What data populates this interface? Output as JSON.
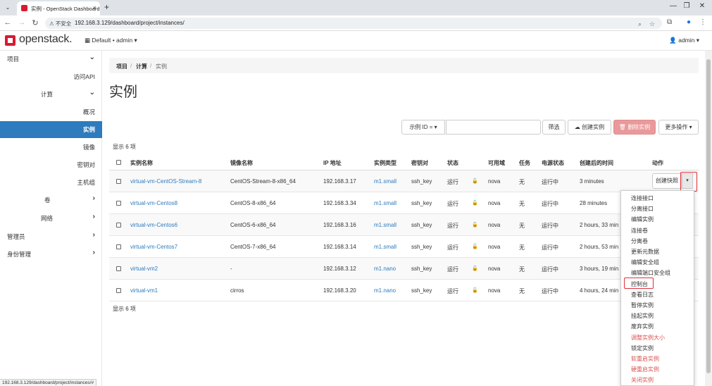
{
  "browser": {
    "tab_title": "实例 - OpenStack Dashboard",
    "tab_close": "×",
    "new_tab": "+",
    "insecure_label": "不安全",
    "url": "192.168.3.129/dashboard/project/instances/",
    "status_url": "192.168.3.129/dashboard/project/instances/#"
  },
  "header": {
    "logo": "openstack.",
    "project_picker": "Default • admin ▾",
    "user_menu": "admin ▾"
  },
  "sidebar": {
    "items": [
      {
        "label": "项目",
        "chevron": "⌄"
      },
      {
        "label": "访问API"
      },
      {
        "label": "计算",
        "chevron": "⌄"
      },
      {
        "label": "概况"
      },
      {
        "label": "实例"
      },
      {
        "label": "镜像"
      },
      {
        "label": "密钥对"
      },
      {
        "label": "主机组"
      },
      {
        "label": "卷",
        "chevron": "›"
      },
      {
        "label": "网络",
        "chevron": "›"
      },
      {
        "label": "管理员",
        "chevron": "›"
      },
      {
        "label": "身份管理",
        "chevron": "›"
      }
    ]
  },
  "breadcrumb": {
    "b1": "项目",
    "b2": "计算",
    "b3": "实例",
    "sep": "/"
  },
  "page_title": "实例",
  "toolbar": {
    "filter_select": "示例 ID = ▾",
    "filter_btn": "筛选",
    "create_btn": "创建实例",
    "delete_btn": "删除实例",
    "more_btn": "更多操作 ▾"
  },
  "count_label": "显示 6 项",
  "table": {
    "headers": [
      "实例名称",
      "镜像名称",
      "IP 地址",
      "实例类型",
      "密钥对",
      "状态",
      "可用域",
      "任务",
      "电源状态",
      "创建后的时间",
      "动作"
    ],
    "rows": [
      {
        "name": "virtual-vm-CentOS-Stream-8",
        "image": "CentOS-Stream-8-x86_64",
        "ip": "192.168.3.17",
        "flavor": "m1.small",
        "key": "ssh_key",
        "status": "运行",
        "zone": "nova",
        "task": "无",
        "power": "运行中",
        "age": "3 minutes"
      },
      {
        "name": "virtual-vm-Centos8",
        "image": "CentOS-8-x86_64",
        "ip": "192.168.3.34",
        "flavor": "m1.small",
        "key": "ssh_key",
        "status": "运行",
        "zone": "nova",
        "task": "无",
        "power": "运行中",
        "age": "28 minutes"
      },
      {
        "name": "virtual-vm-Centos6",
        "image": "CentOS-6-x86_64",
        "ip": "192.168.3.16",
        "flavor": "m1.small",
        "key": "ssh_key",
        "status": "运行",
        "zone": "nova",
        "task": "无",
        "power": "运行中",
        "age": "2 hours, 33 min"
      },
      {
        "name": "virtual-vm-Centos7",
        "image": "CentOS-7-x86_64",
        "ip": "192.168.3.14",
        "flavor": "m1.small",
        "key": "ssh_key",
        "status": "运行",
        "zone": "nova",
        "task": "无",
        "power": "运行中",
        "age": "2 hours, 53 min"
      },
      {
        "name": "virtual-vm2",
        "image": "-",
        "ip": "192.168.3.12",
        "flavor": "m1.nano",
        "key": "ssh_key",
        "status": "运行",
        "zone": "nova",
        "task": "无",
        "power": "运行中",
        "age": "3 hours, 19 min"
      },
      {
        "name": "virtual-vm1",
        "image": "cirros",
        "ip": "192.168.3.20",
        "flavor": "m1.nano",
        "key": "ssh_key",
        "status": "运行",
        "zone": "nova",
        "task": "无",
        "power": "运行中",
        "age": "4 hours, 24 min"
      }
    ]
  },
  "row_action": {
    "label": "创建快照",
    "caret": "▾"
  },
  "dropdown": {
    "items": [
      {
        "label": "连接接口",
        "danger": false
      },
      {
        "label": "分离接口",
        "danger": false
      },
      {
        "label": "编辑实例",
        "danger": false
      },
      {
        "label": "连接卷",
        "danger": false
      },
      {
        "label": "分离卷",
        "danger": false
      },
      {
        "label": "更新元数据",
        "danger": false
      },
      {
        "label": "编辑安全组",
        "danger": false
      },
      {
        "label": "编辑端口安全组",
        "danger": false
      },
      {
        "label": "控制台",
        "danger": false
      },
      {
        "label": "查看日志",
        "danger": false
      },
      {
        "label": "暂停实例",
        "danger": false
      },
      {
        "label": "挂起实例",
        "danger": false
      },
      {
        "label": "废弃实例",
        "danger": false
      },
      {
        "label": "调整实例大小",
        "danger": true
      },
      {
        "label": "锁定实例",
        "danger": false
      },
      {
        "label": "软重启实例",
        "danger": true
      },
      {
        "label": "硬重启实例",
        "danger": true
      },
      {
        "label": "关闭实例",
        "danger": true
      }
    ]
  },
  "colors": {
    "accent": "#2e7bbd",
    "brand": "#da1a32",
    "highlight": "#e0303a",
    "danger_text": "#d9534f"
  }
}
